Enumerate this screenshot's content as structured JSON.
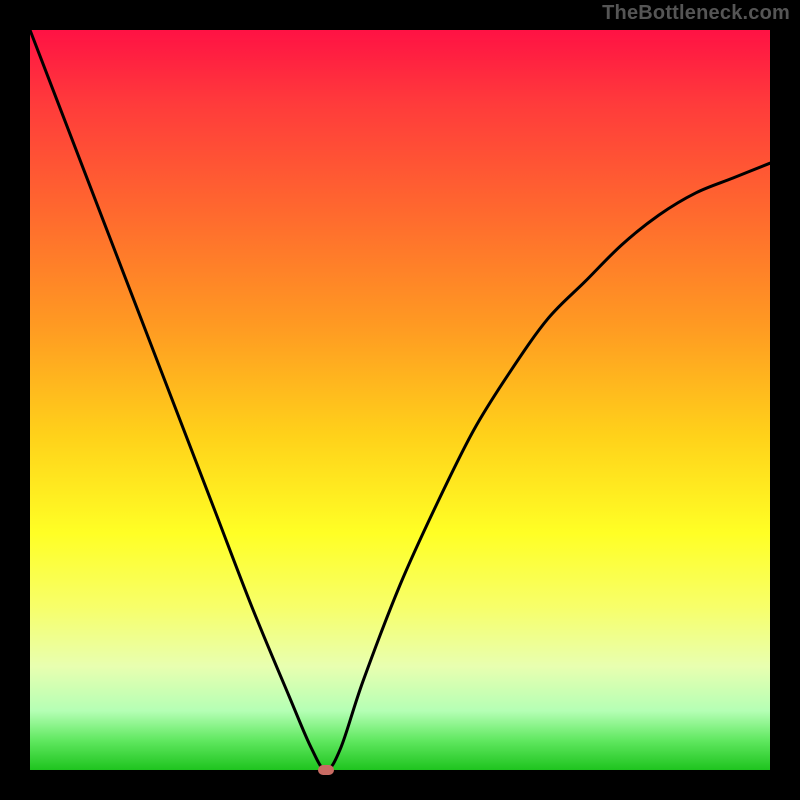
{
  "watermark": "TheBottleneck.com",
  "chart_data": {
    "type": "line",
    "title": "",
    "xlabel": "",
    "ylabel": "",
    "xlim": [
      0,
      100
    ],
    "ylim": [
      0,
      100
    ],
    "background": "rainbow-gradient",
    "gradient_stops": [
      {
        "pos": 0,
        "color": "#ff1244"
      },
      {
        "pos": 25,
        "color": "#ff6a2e"
      },
      {
        "pos": 55,
        "color": "#ffd21a"
      },
      {
        "pos": 78,
        "color": "#f7ff6a"
      },
      {
        "pos": 96,
        "color": "#60e860"
      },
      {
        "pos": 100,
        "color": "#1ec41e"
      }
    ],
    "series": [
      {
        "name": "bottleneck-curve",
        "x": [
          0,
          5,
          10,
          15,
          20,
          25,
          30,
          35,
          38,
          40,
          42,
          45,
          50,
          55,
          60,
          65,
          70,
          75,
          80,
          85,
          90,
          95,
          100
        ],
        "y": [
          100,
          87,
          74,
          61,
          48,
          35,
          22,
          10,
          3,
          0,
          3,
          12,
          25,
          36,
          46,
          54,
          61,
          66,
          71,
          75,
          78,
          80,
          82
        ]
      }
    ],
    "marker": {
      "x": 40,
      "y": 0,
      "color": "#c96b63"
    }
  }
}
